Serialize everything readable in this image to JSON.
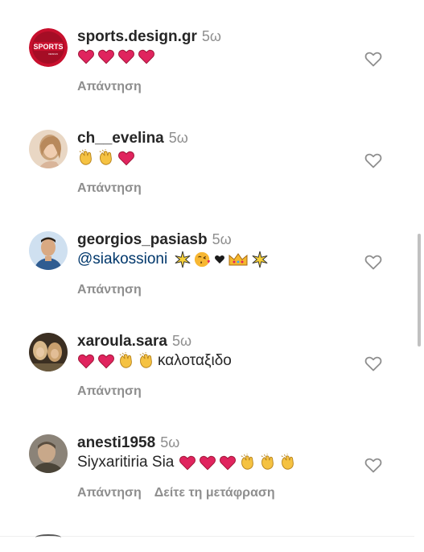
{
  "comments": [
    {
      "username": "sports.design.gr",
      "time": "5ω",
      "text_before": "",
      "mention": "",
      "text_after": "",
      "emojis": [
        "heart",
        "heart",
        "heart",
        "heart"
      ],
      "actions": [
        "Απάντηση"
      ],
      "avatar_text": "SPORTS",
      "avatar_color": "#c8102e"
    },
    {
      "username": "ch__evelina",
      "time": "5ω",
      "text_before": "",
      "mention": "",
      "text_after": "",
      "emojis": [
        "clap",
        "clap",
        "heart"
      ],
      "actions": [
        "Απάντηση"
      ],
      "avatar_color": "#d8b79a"
    },
    {
      "username": "georgios_pasiasb",
      "time": "5ω",
      "text_before": "",
      "mention": "@siakossioni",
      "text_after": "",
      "emojis": [
        "sparkle",
        "kiss",
        "black-heart",
        "crown",
        "sparkle"
      ],
      "actions": [
        "Απάντηση"
      ],
      "avatar_color": "#4a6fa5"
    },
    {
      "username": "xaroula.sara",
      "time": "5ω",
      "text_before": "",
      "mention": "",
      "text_after": "καλοταξιδο",
      "emojis": [
        "heart",
        "heart",
        "clap",
        "clap"
      ],
      "actions": [
        "Απάντηση"
      ],
      "avatar_color": "#6b5a3e"
    },
    {
      "username": "anesti1958",
      "time": "5ω",
      "text_before": "Siyxaritiria Sia",
      "mention": "",
      "text_after": "",
      "emojis": [
        "heart",
        "heart",
        "heart",
        "clap",
        "clap",
        "clap"
      ],
      "actions": [
        "Απάντηση",
        "Δείτε τη μετάφραση"
      ],
      "avatar_color": "#7a7468"
    }
  ],
  "colors": {
    "heart": "#e0245e",
    "clap": "#f5c242",
    "mention": "#00376b",
    "muted": "#8e8e8e"
  }
}
